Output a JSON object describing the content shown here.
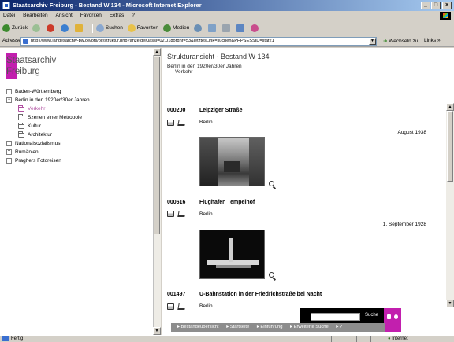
{
  "window": {
    "title": "Staatsarchiv Freiburg - Bestand W 134 - Microsoft Internet Explorer",
    "controls": [
      "_",
      "□",
      "×"
    ]
  },
  "menu": [
    "Datei",
    "Bearbeiten",
    "Ansicht",
    "Favoriten",
    "Extras",
    "?"
  ],
  "toolbar": {
    "back": "Zurück",
    "search": "Suchen",
    "favorites": "Favoriten",
    "media": "Medien"
  },
  "address": {
    "label": "Adresse",
    "url": "http://www.landesarchiv-bw.de/ofs/olf/struktur.php?anzeigeKlassi=02.018ordnr=53&letztesLink=suchen&PHPSESSID=staf21",
    "go": "Wechseln zu",
    "links": "Links »"
  },
  "sidebar": {
    "logo_line1": "Staatsarchiv",
    "logo_line2": "Freiburg",
    "items": [
      {
        "label": "Baden-Württemberg",
        "type": "plus"
      },
      {
        "label": "Berlin in den 1920er/30er Jahren",
        "type": "minus"
      },
      {
        "label": "Verkehr",
        "type": "folder",
        "active": true
      },
      {
        "label": "Szenen einer Metropole",
        "type": "folder"
      },
      {
        "label": "Kultur",
        "type": "folder"
      },
      {
        "label": "Architektur",
        "type": "folder"
      },
      {
        "label": "Nationalsozialismus",
        "type": "plus"
      },
      {
        "label": "Rumänien",
        "type": "plus"
      },
      {
        "label": "Praghers Fotoreisen",
        "type": "box"
      }
    ]
  },
  "main": {
    "title": "Strukturansicht - Bestand W 134",
    "breadcrumb_1": "Berlin in den 1920er/30er Jahren",
    "breadcrumb_2": "Verkehr",
    "records": [
      {
        "sig": "000200",
        "title": "Leipziger Straße",
        "place": "Berlin",
        "date": "August 1938"
      },
      {
        "sig": "000616",
        "title": "Flughafen Tempelhof",
        "place": "Berlin",
        "date": "1. September 1928"
      },
      {
        "sig": "001497",
        "title": "U-Bahnstation in der Friedrichstraße bei Nacht",
        "place": "Berlin",
        "date": ""
      }
    ]
  },
  "footer": {
    "links": [
      "Beständeübersicht",
      "Startseite",
      "Einführung",
      "Erweiterte Suche",
      "?"
    ],
    "search_button": "Suche"
  },
  "status": {
    "text": "Fertig",
    "zone": "Internet"
  },
  "colors": {
    "accent": "#c21fae",
    "titlebar": "#0a246a"
  }
}
